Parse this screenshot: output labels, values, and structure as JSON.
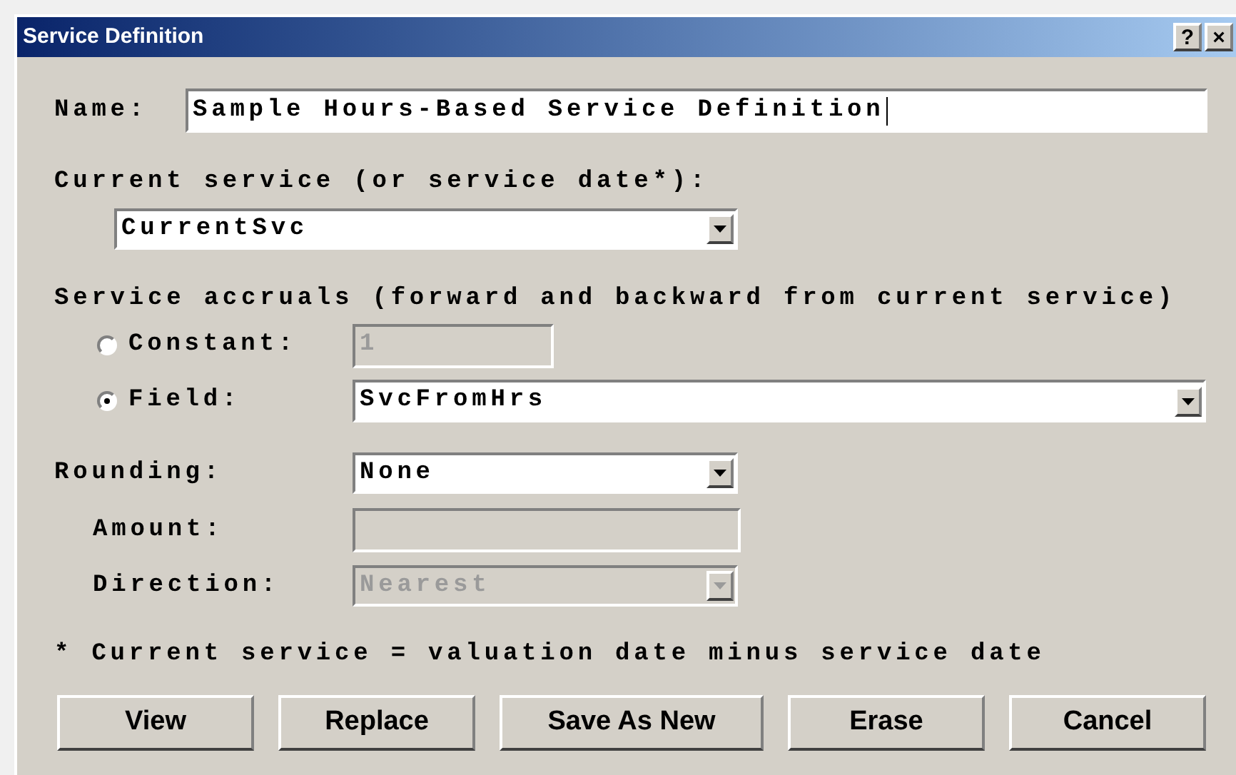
{
  "window": {
    "title": "Service Definition",
    "title_buttons": [
      "?",
      "×"
    ]
  },
  "name": {
    "label": "Name:",
    "value": "Sample Hours-Based Service Definition"
  },
  "current_service": {
    "label": "Current service (or service date*):",
    "value": "CurrentSvc"
  },
  "accruals": {
    "label": "Service accruals (forward and backward from current service)",
    "options": [
      {
        "kind": "text",
        "label": "Constant:",
        "selected": false,
        "value": "1",
        "disabled": true
      },
      {
        "kind": "dropdown",
        "label": "Field:",
        "selected": true,
        "value": "SvcFromHrs",
        "disabled": false
      }
    ]
  },
  "rounding": {
    "label": "Rounding:",
    "value": "None",
    "disabled": false,
    "sub_fields": [
      {
        "kind": "text",
        "label": "Amount:",
        "disabled": true
      },
      {
        "kind": "dropdown",
        "label": "Direction:",
        "value": "Nearest",
        "disabled": true
      }
    ]
  },
  "footnote": "* Current service = valuation date minus service date",
  "buttons": [
    {
      "label": "View"
    },
    {
      "label": "Replace"
    },
    {
      "label": "Save As New"
    },
    {
      "label": "Erase"
    },
    {
      "label": "Cancel"
    }
  ]
}
